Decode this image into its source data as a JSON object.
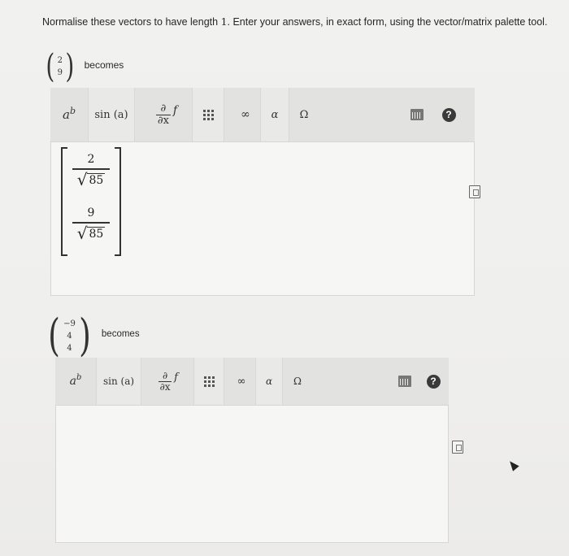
{
  "question": {
    "text_before": "Normalise these vectors to have length ",
    "number": "1",
    "text_after": ". Enter your answers, in exact form, using the vector/matrix palette tool."
  },
  "items": [
    {
      "vector": [
        "2",
        "9"
      ],
      "becomes_label": "becomes",
      "toolbar": {
        "power": "a",
        "power_sup": "b",
        "sin": "sin (a)",
        "deriv_top": "∂",
        "deriv_bottom": "∂x",
        "deriv_f": "f",
        "infinity": "∞",
        "alpha": "α",
        "omega": "Ω",
        "help": "?"
      },
      "answer": [
        {
          "numerator": "2",
          "radicand": "85"
        },
        {
          "numerator": "9",
          "radicand": "85"
        }
      ]
    },
    {
      "vector": [
        "−9",
        "4",
        "4"
      ],
      "becomes_label": "becomes",
      "toolbar": {
        "power": "a",
        "power_sup": "b",
        "sin": "sin (a)",
        "deriv_top": "∂",
        "deriv_bottom": "∂x",
        "deriv_f": "f",
        "infinity": "∞",
        "alpha": "α",
        "omega": "Ω",
        "help": "?"
      },
      "answer": []
    }
  ]
}
